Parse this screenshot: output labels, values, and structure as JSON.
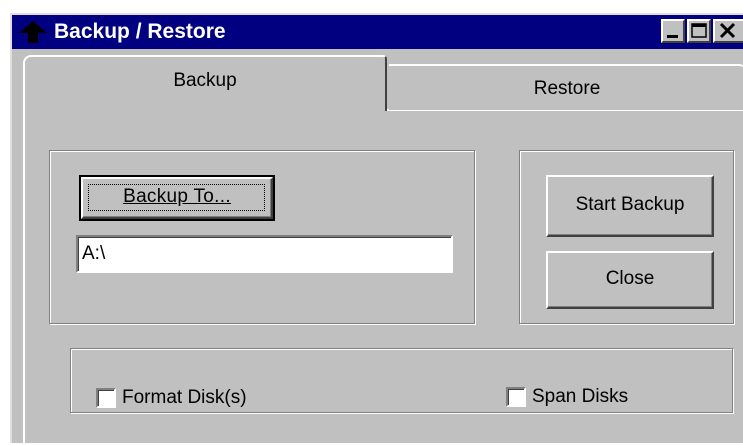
{
  "window": {
    "title": "Backup / Restore",
    "controls": [
      "minimize",
      "maximize",
      "close"
    ]
  },
  "tabs": [
    {
      "label": "Backup",
      "selected": true
    },
    {
      "label": "Restore",
      "selected": false
    }
  ],
  "backup_panel": {
    "backup_to_label": "Backup To...",
    "destination_value": "A:\\",
    "start_backup_label": "Start Backup",
    "close_label": "Close",
    "options": {
      "format_disks": {
        "label": "Format Disk(s)",
        "checked": false
      },
      "span_disks": {
        "label": "Span Disks",
        "checked": false
      }
    }
  },
  "icons": {
    "title": "up-arrow-icon",
    "minimize": "minimize-icon",
    "maximize": "maximize-icon",
    "close": "close-icon"
  },
  "colors": {
    "titlebar": "#000080",
    "face": "#c0c0c0",
    "title_text": "#ffffff"
  }
}
